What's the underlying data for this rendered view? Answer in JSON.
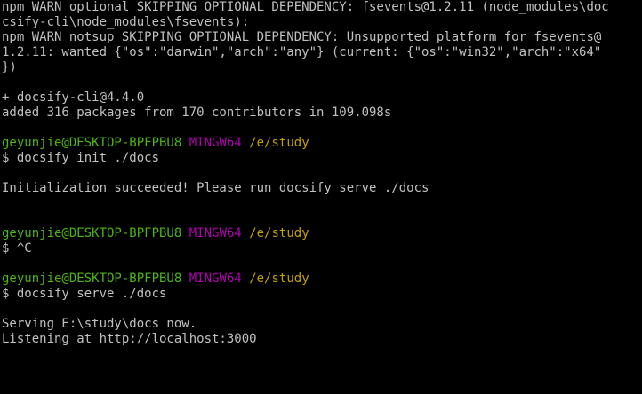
{
  "terminal": {
    "output_lines": [
      "npm WARN optional SKIPPING OPTIONAL DEPENDENCY: fsevents@1.2.11 (node_modules\\doc",
      "csify-cli\\node_modules\\fsevents):",
      "npm WARN notsup SKIPPING OPTIONAL DEPENDENCY: Unsupported platform for fsevents@",
      "1.2.11: wanted {\"os\":\"darwin\",\"arch\":\"any\"} (current: {\"os\":\"win32\",\"arch\":\"x64\"",
      "})",
      "+ docsify-cli@4.4.0",
      "added 316 packages from 170 contributors in 109.098s"
    ],
    "prompt": {
      "user_host": "geyunjie@DESKTOP-BPFPBU8",
      "system": "MINGW64",
      "path": "/e/study"
    },
    "commands": [
      "$ docsify init ./docs",
      "$ ^C",
      "$ docsify serve ./docs"
    ],
    "init_output": "Initialization succeeded! Please run docsify serve ./docs",
    "serve_output": [
      "Serving E:\\study\\docs now.",
      "Listening at http://localhost:3000"
    ],
    "colors": {
      "background": "#000000",
      "text": "#c0c0c0",
      "user_host": "#4cb414",
      "system": "#b000b0",
      "path": "#c4a000"
    }
  }
}
